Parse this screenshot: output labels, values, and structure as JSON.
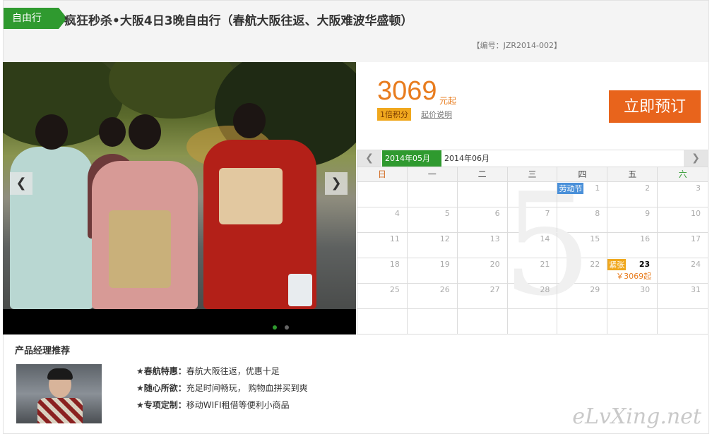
{
  "header": {
    "tag": "自由行",
    "title": "疯狂秒杀•大阪4日3晚自由行（春航大阪往返、大阪难波华盛顿）",
    "code": "【编号：JZR2014-002】"
  },
  "gallery": {
    "prev_icon": "chevron-left-icon",
    "next_icon": "chevron-right-icon",
    "prev_symbol": "❮",
    "next_symbol": "❯",
    "slides_total": 2,
    "active_slide": 1
  },
  "price": {
    "amount": "3069",
    "unit": "元起",
    "points": "1倍积分",
    "note_link": "起价说明",
    "book_button": "立即预订",
    "accent": "#e87c1e",
    "button_color": "#e8641c"
  },
  "calendar": {
    "prev_symbol": "❮",
    "next_symbol": "❯",
    "months": [
      "2014年05月",
      "2014年06月"
    ],
    "active_month_index": 0,
    "big_month": "5",
    "weekdays": [
      "日",
      "一",
      "二",
      "三",
      "四",
      "五",
      "六"
    ],
    "weekday_colors": [
      "#d2691e",
      "#444",
      "#444",
      "#444",
      "#444",
      "#444",
      "#2f9a2f"
    ],
    "rows": [
      [
        "",
        "",
        "",
        "",
        "1",
        "2",
        "3"
      ],
      [
        "4",
        "5",
        "6",
        "7",
        "8",
        "9",
        "10"
      ],
      [
        "11",
        "12",
        "13",
        "14",
        "15",
        "16",
        "17"
      ],
      [
        "18",
        "19",
        "20",
        "21",
        "22",
        "23",
        "24"
      ],
      [
        "25",
        "26",
        "27",
        "28",
        "29",
        "30",
        "31"
      ],
      [
        "",
        "",
        "",
        "",
        "",
        "",
        ""
      ]
    ],
    "holiday": {
      "label": "劳动节",
      "row": 0,
      "col": 4
    },
    "tight": {
      "label": "紧张",
      "row": 3,
      "col": 5,
      "price": "￥3069起"
    }
  },
  "manager": {
    "title": "产品经理推荐",
    "features": [
      {
        "label": "★春航特惠：",
        "text": "春航大阪往返，优惠十足"
      },
      {
        "label": "★随心所欲：",
        "text": "充足时间畅玩， 购物血拼买到爽"
      },
      {
        "label": "★专项定制：",
        "text": "移动WIFI租借等便利小商品"
      }
    ],
    "watermark": "eLvXing.net"
  }
}
